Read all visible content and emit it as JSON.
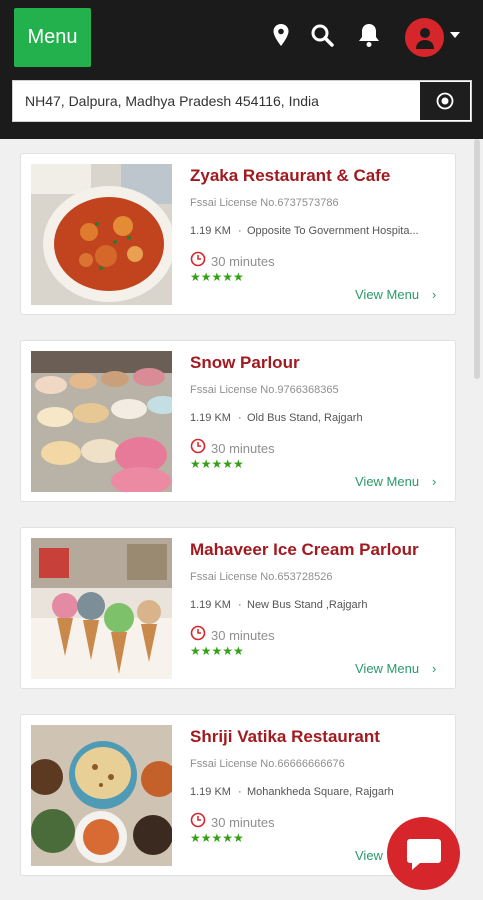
{
  "header": {
    "menu_label": "Menu",
    "icons": [
      "location-pin-icon",
      "search-icon",
      "bell-icon",
      "user-avatar-icon",
      "caret-down-icon"
    ],
    "accent_green": "#22b14c",
    "brand_red": "#d7262b"
  },
  "search": {
    "value": "NH47, Dalpura, Madhya Pradesh 454116, India",
    "locate_icon": "crosshair-icon"
  },
  "restaurants": [
    {
      "name": "Zyaka Restaurant & Cafe",
      "license": "Fssai License No.6737573786",
      "distance": "1.19 KM",
      "address": "Opposite To Government Hospita...",
      "time": "30 minutes",
      "stars": "★★★★★",
      "view_menu": "View Menu",
      "image": "curry-bowl-photo"
    },
    {
      "name": "Snow Parlour",
      "license": "Fssai License No.9766368365",
      "distance": "1.19 KM",
      "address": "Old Bus Stand, Rajgarh",
      "time": "30 minutes",
      "stars": "★★★★★",
      "view_menu": "View Menu",
      "image": "ice-cream-display-photo"
    },
    {
      "name": "Mahaveer Ice Cream Parlour",
      "license": "Fssai License No.653728526",
      "distance": "1.19 KM",
      "address": "New Bus Stand ,Rajgarh",
      "time": "30 minutes",
      "stars": "★★★★★",
      "view_menu": "View Menu",
      "image": "ice-cream-cones-photo"
    },
    {
      "name": "Shriji Vatika Restaurant",
      "license": "Fssai License No.66666666676",
      "distance": "1.19 KM",
      "address": "Mohankheda Square, Rajgarh",
      "time": "30 minutes",
      "stars": "★★★★★",
      "view_menu": "View",
      "image": "thali-naan-photo"
    }
  ],
  "chat_icon": "chat-bubble-icon"
}
